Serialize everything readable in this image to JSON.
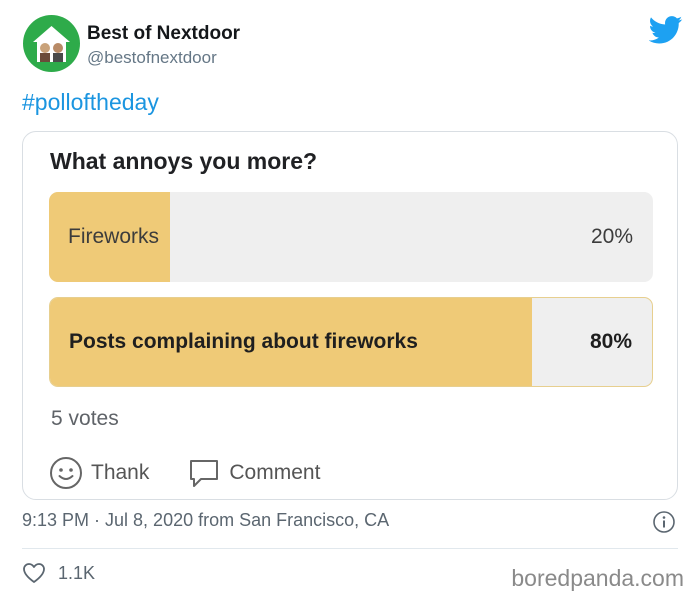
{
  "tweet": {
    "display_name": "Best of Nextdoor",
    "handle": "@bestofnextdoor",
    "hashtag": "#polloftheday",
    "timestamp": "9:13 PM · Jul 8, 2020 from San Francisco, CA",
    "likes": "1.1K"
  },
  "poll": {
    "question": "What annoys you more?",
    "options": [
      {
        "label": "Fireworks",
        "percent_text": "20%",
        "fraction": 0.2
      },
      {
        "label": "Posts complaining about fireworks",
        "percent_text": "80%",
        "fraction": 0.8
      }
    ],
    "votes": "5 votes",
    "actions": {
      "thank": "Thank",
      "comment": "Comment"
    }
  },
  "watermark": "boredpanda.com",
  "colors": {
    "brand_green": "#2eab4a",
    "twitter_blue": "#1da1f2",
    "poll_fill": "#efca77",
    "poll_track": "#efefef"
  },
  "icons": [
    "nextdoor-logo",
    "twitter-bird-icon",
    "smiley-icon",
    "comment-bubble-icon",
    "info-icon",
    "heart-icon"
  ]
}
